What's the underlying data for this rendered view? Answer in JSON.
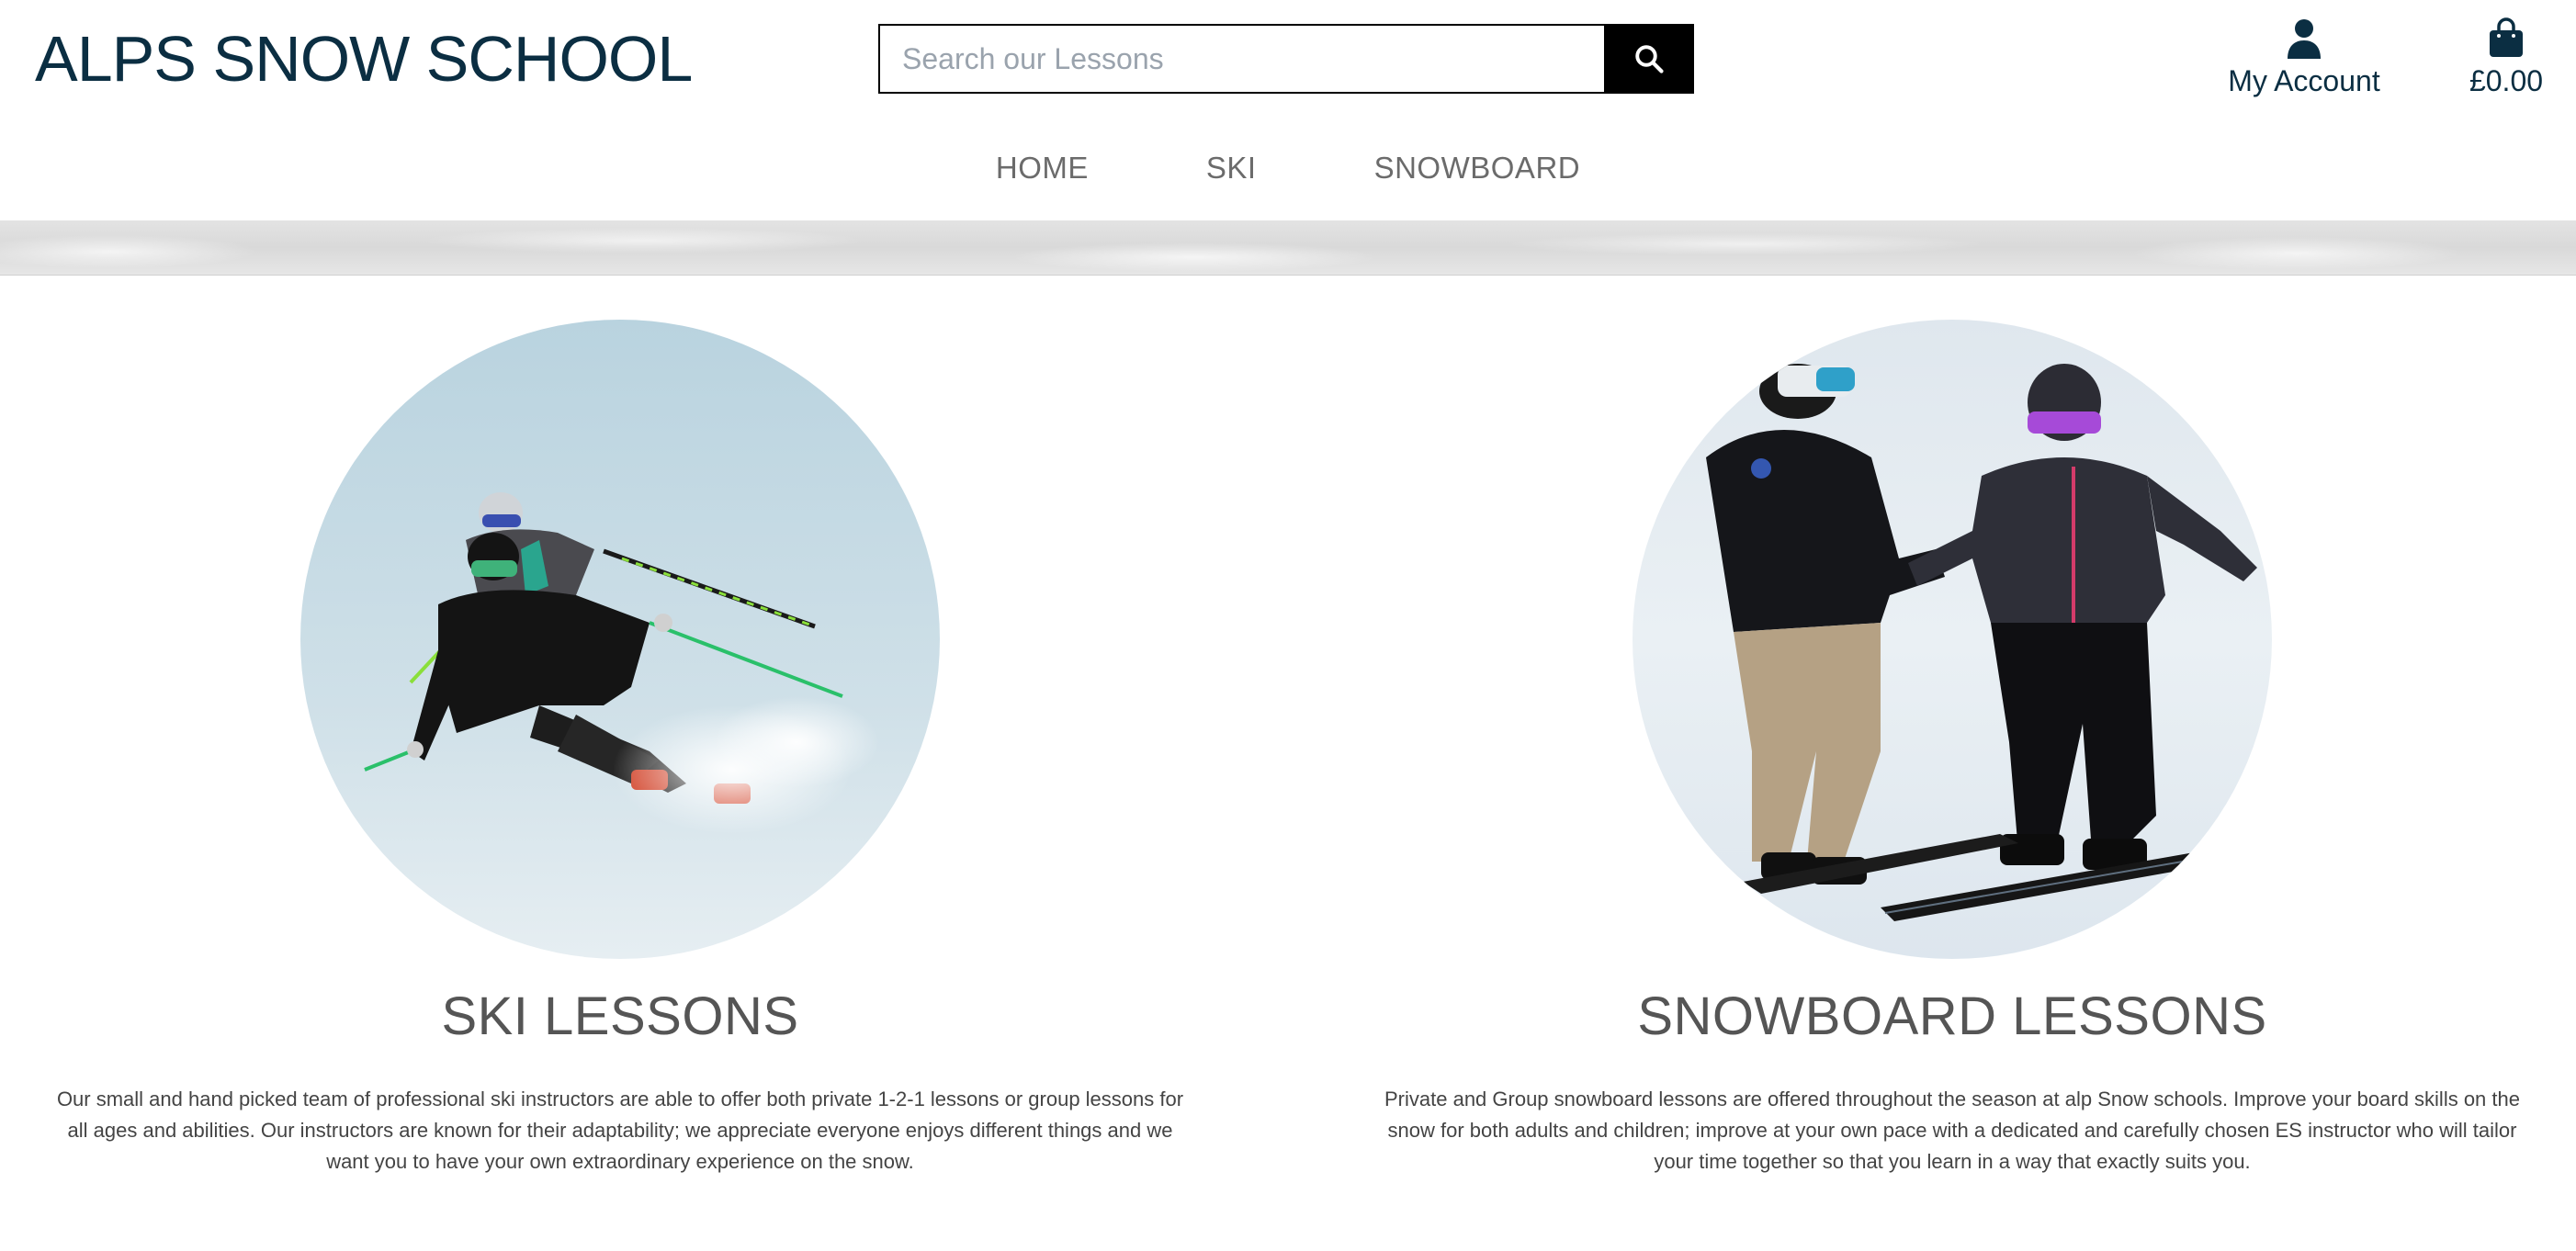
{
  "header": {
    "brand": "ALPS SNOW SCHOOL",
    "search": {
      "placeholder": "Search our Lessons",
      "value": ""
    },
    "account_label": "My Account",
    "bag_total": "£0.00"
  },
  "nav": {
    "items": [
      {
        "label": "HOME"
      },
      {
        "label": "SKI"
      },
      {
        "label": "SNOWBOARD"
      }
    ]
  },
  "lessons": [
    {
      "title": "SKI LESSONS",
      "description": "Our small and hand picked team of professional ski instructors are able to offer both private 1-2-1 lessons or group lessons for all ages and abilities. Our instructors are known for their adaptability; we appreciate everyone enjoys different things and we want you to have your own extraordinary experience on the snow."
    },
    {
      "title": "SNOWBOARD LESSONS",
      "description": "Private and Group snowboard lessons are offered throughout the season at alp Snow schools. Improve your board skills on the snow for both adults and children; improve at your own pace with a dedicated and carefully chosen ES instructor who will tailor your time together so that you learn in a way that exactly suits you."
    }
  ],
  "colors": {
    "brand": "#0b2e42",
    "nav_text": "#6b6b6b",
    "heading": "#555555",
    "body_text": "#444444",
    "search_button": "#000000"
  },
  "icons": {
    "search": "search-icon",
    "account": "user-icon",
    "bag": "shopping-bag-icon"
  }
}
